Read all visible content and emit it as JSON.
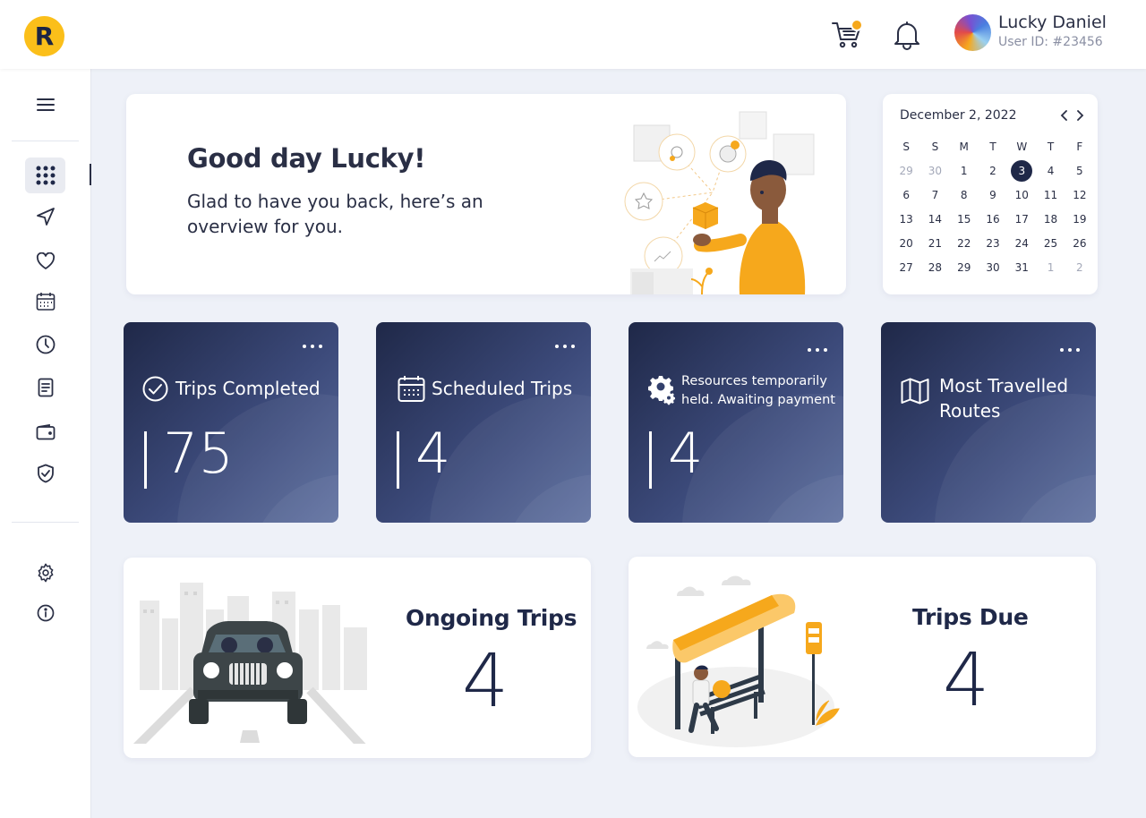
{
  "header": {
    "logo_letter": "R",
    "user_name": "Lucky Daniel",
    "user_id": "User ID: #23456",
    "cart_icon": "cart-icon",
    "bell_icon": "bell-icon",
    "accent_color": "#f6a81c"
  },
  "sidebar": {
    "items": [
      {
        "name": "menu",
        "icon": "hamburger-icon"
      },
      {
        "name": "dashboard",
        "icon": "grid-icon",
        "active": true
      },
      {
        "name": "navigate",
        "icon": "navigation-icon"
      },
      {
        "name": "favorites",
        "icon": "heart-icon"
      },
      {
        "name": "calendar",
        "icon": "calendar-icon"
      },
      {
        "name": "history",
        "icon": "clock-icon"
      },
      {
        "name": "documents",
        "icon": "document-icon"
      },
      {
        "name": "wallet",
        "icon": "wallet-icon"
      },
      {
        "name": "security",
        "icon": "shield-check-icon"
      },
      {
        "name": "settings",
        "icon": "gear-icon"
      },
      {
        "name": "info",
        "icon": "info-icon"
      }
    ]
  },
  "welcome": {
    "title": "Good day Lucky!",
    "subtitle": "Glad to have you back, here’s an overview for you."
  },
  "calendar": {
    "month_label": "December 2, 2022",
    "weekdays": [
      "S",
      "S",
      "M",
      "T",
      "W",
      "T",
      "F"
    ],
    "days": [
      {
        "d": "29",
        "muted": true
      },
      {
        "d": "30",
        "muted": true
      },
      {
        "d": "1"
      },
      {
        "d": "2"
      },
      {
        "d": "3",
        "selected": true
      },
      {
        "d": "4"
      },
      {
        "d": "5"
      },
      {
        "d": "6"
      },
      {
        "d": "7"
      },
      {
        "d": "8"
      },
      {
        "d": "9"
      },
      {
        "d": "10"
      },
      {
        "d": "11"
      },
      {
        "d": "12"
      },
      {
        "d": "13"
      },
      {
        "d": "14"
      },
      {
        "d": "15"
      },
      {
        "d": "16"
      },
      {
        "d": "17"
      },
      {
        "d": "18"
      },
      {
        "d": "19"
      },
      {
        "d": "20"
      },
      {
        "d": "21"
      },
      {
        "d": "22"
      },
      {
        "d": "23"
      },
      {
        "d": "24"
      },
      {
        "d": "25"
      },
      {
        "d": "26"
      },
      {
        "d": "27"
      },
      {
        "d": "28"
      },
      {
        "d": "29"
      },
      {
        "d": "30"
      },
      {
        "d": "31"
      },
      {
        "d": "1",
        "muted": true
      },
      {
        "d": "2",
        "muted": true
      }
    ]
  },
  "stats": [
    {
      "label": "Trips Completed",
      "value": "75",
      "icon": "check-circle-icon"
    },
    {
      "label": "Scheduled Trips",
      "value": "4",
      "icon": "calendar-icon"
    },
    {
      "label": "Resources temporarily held. Awaiting payment",
      "value": "4",
      "icon": "gears-icon"
    },
    {
      "label": "Most Travelled Routes",
      "value": "",
      "icon": "map-icon"
    }
  ],
  "ongoing": {
    "title": "Ongoing Trips",
    "value": "4"
  },
  "due": {
    "title": "Trips Due",
    "value": "4"
  }
}
